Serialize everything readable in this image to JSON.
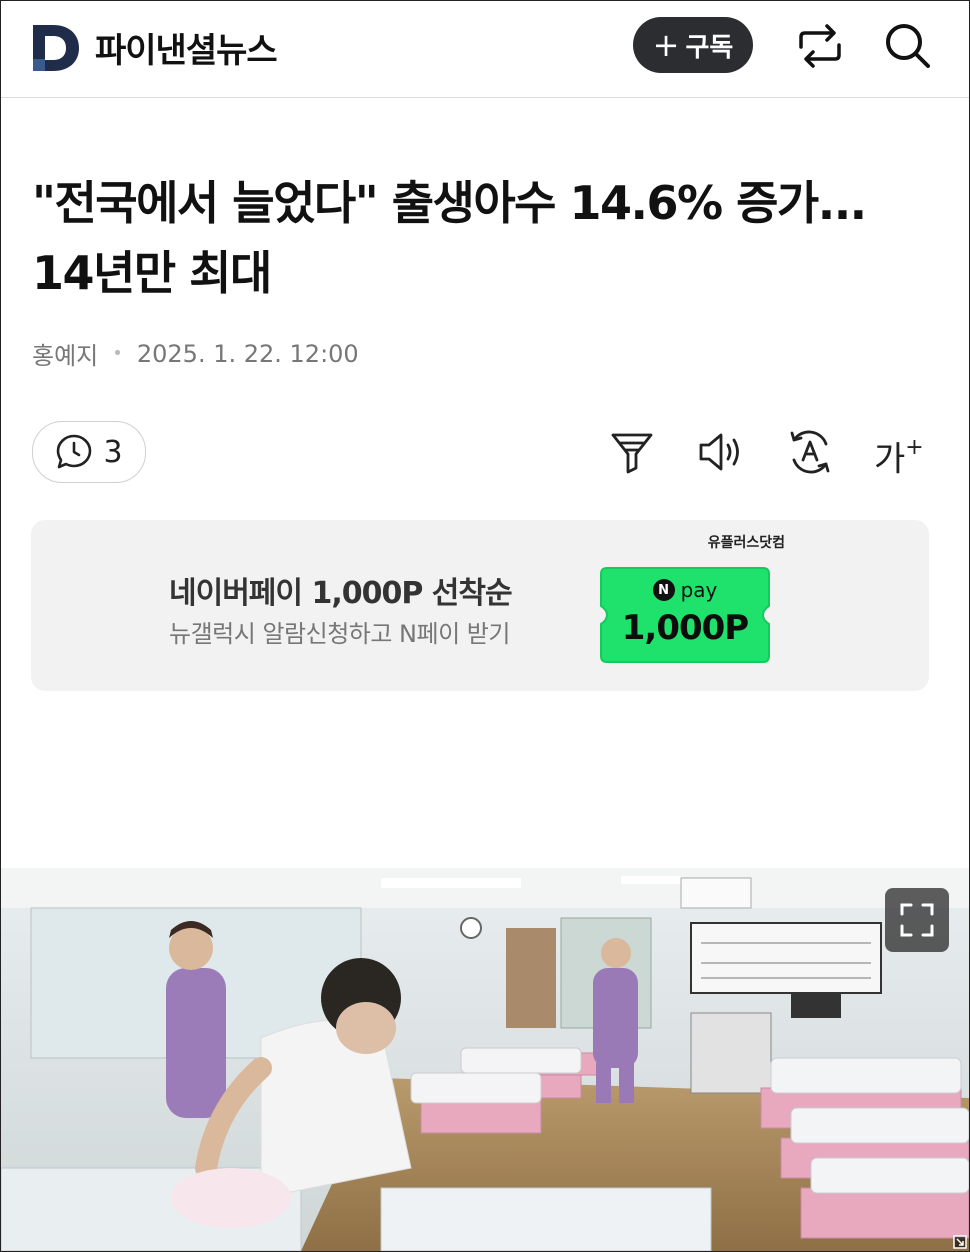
{
  "header": {
    "brand_name": "파이낸셜뉴스",
    "subscribe_label": "구독",
    "icons": [
      "logo-d-icon",
      "share-icon",
      "search-icon"
    ]
  },
  "article": {
    "headline_line1": "\"전국에서 늘었다\" 출생아수 14.6% 증가...",
    "headline_line2": "14년만 최대",
    "author": "홍예지",
    "datetime": "2025. 1. 22. 12:00"
  },
  "toolbar": {
    "comment_count": "3",
    "icons": [
      "comment-icon",
      "filter-icon",
      "speaker-icon",
      "translate-icon",
      "font-size-icon"
    ],
    "font_size_label": "가"
  },
  "ad": {
    "advertiser": "유플러스닷컴",
    "title": "네이버페이 1,000P 선착순",
    "subtitle": "뉴갤럭시 알람신청하고 N페이 받기",
    "coupon_brand": "pay",
    "coupon_badge": "N",
    "coupon_value": "1,000P",
    "coupon_color": "#1ee26b"
  },
  "photo": {
    "alt": "신생아실에서 간호사들이 신생아를 돌보고 있다",
    "expand_icon": "expand-icon"
  },
  "colors": {
    "accent_dark": "#2b2d31",
    "logo_blue": "#1f2d4a",
    "ad_background": "#f2f2f2"
  }
}
